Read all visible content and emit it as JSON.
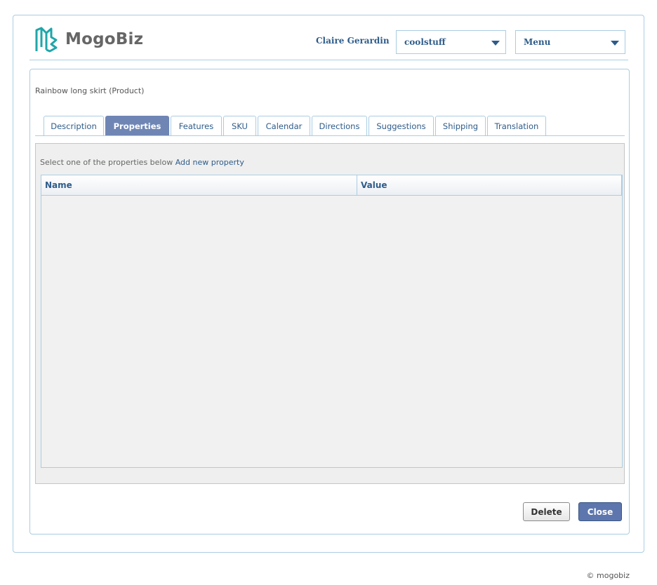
{
  "header": {
    "brand": "MogoBiz",
    "user_name": "Claire Gerardin",
    "store_select": "coolstuff",
    "menu_select": "Menu"
  },
  "product": {
    "title": "Rainbow long skirt (Product)"
  },
  "tabs": [
    {
      "label": "Description"
    },
    {
      "label": "Properties"
    },
    {
      "label": "Features"
    },
    {
      "label": "SKU"
    },
    {
      "label": "Calendar"
    },
    {
      "label": "Directions"
    },
    {
      "label": "Suggestions"
    },
    {
      "label": "Shipping"
    },
    {
      "label": "Translation"
    }
  ],
  "active_tab": "Properties",
  "properties": {
    "hint": "Select one of the properties below",
    "add_link": "Add new property",
    "columns": [
      "Name",
      "Value"
    ],
    "rows": []
  },
  "actions": {
    "delete_label": "Delete",
    "close_label": "Close"
  },
  "footer": {
    "copyright": "© mogobiz"
  },
  "colors": {
    "accent": "#2e5c8a",
    "border": "#a9cde3",
    "active_tab": "#6f86b5",
    "logo_teal": "#1fa6a9"
  }
}
